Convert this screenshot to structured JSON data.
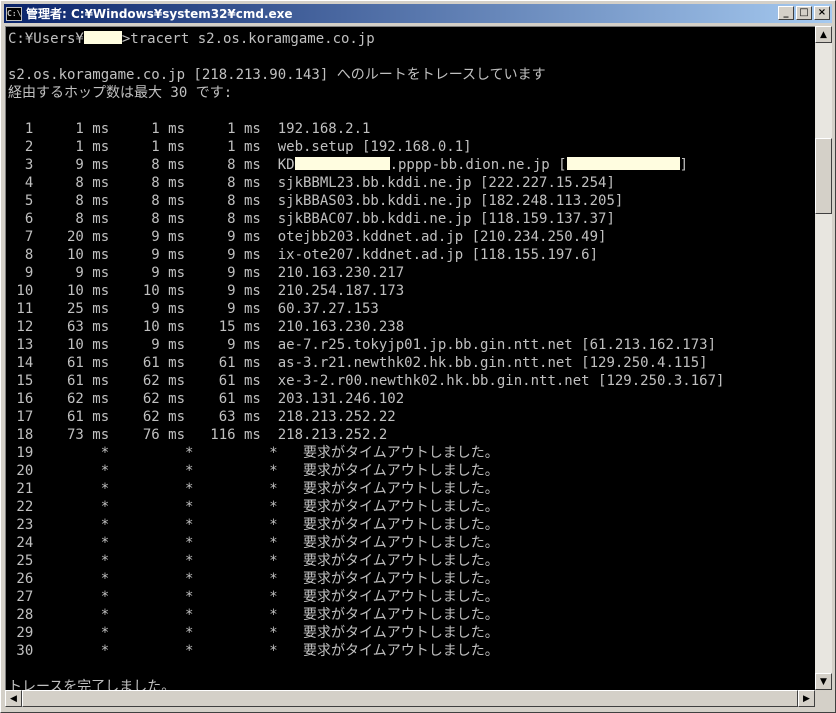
{
  "window": {
    "title": "管理者: C:¥Windows¥system32¥cmd.exe",
    "icon": "cmd-icon",
    "icon_text": "C:\\",
    "buttons": {
      "minimize": "_",
      "maximize": "□",
      "close": "×"
    }
  },
  "console": {
    "prompt_before": "C:¥Users¥",
    "prompt_after": ">tracert s2.os.koramgame.co.jp",
    "header1": "s2.os.koramgame.co.jp [218.213.90.143] へのルートをトレースしています",
    "header2": "経由するホップ数は最大 30 です:",
    "hops": [
      {
        "n": "1",
        "t1": "1 ms",
        "t2": "1 ms",
        "t3": "1 ms",
        "host": "192.168.2.1"
      },
      {
        "n": "2",
        "t1": "1 ms",
        "t2": "1 ms",
        "t3": "1 ms",
        "host": "web.setup [192.168.0.1]"
      },
      {
        "n": "3",
        "t1": "9 ms",
        "t2": "8 ms",
        "t3": "8 ms",
        "host": "KD",
        "host_mid": ".pppp-bb.dion.ne.jp [",
        "host_end": "]"
      },
      {
        "n": "4",
        "t1": "8 ms",
        "t2": "8 ms",
        "t3": "8 ms",
        "host": "sjkBBML23.bb.kddi.ne.jp [222.227.15.254]"
      },
      {
        "n": "5",
        "t1": "8 ms",
        "t2": "8 ms",
        "t3": "8 ms",
        "host": "sjkBBAS03.bb.kddi.ne.jp [182.248.113.205]"
      },
      {
        "n": "6",
        "t1": "8 ms",
        "t2": "8 ms",
        "t3": "8 ms",
        "host": "sjkBBAC07.bb.kddi.ne.jp [118.159.137.37]"
      },
      {
        "n": "7",
        "t1": "20 ms",
        "t2": "9 ms",
        "t3": "9 ms",
        "host": "otejbb203.kddnet.ad.jp [210.234.250.49]"
      },
      {
        "n": "8",
        "t1": "10 ms",
        "t2": "9 ms",
        "t3": "9 ms",
        "host": "ix-ote207.kddnet.ad.jp [118.155.197.6]"
      },
      {
        "n": "9",
        "t1": "9 ms",
        "t2": "9 ms",
        "t3": "9 ms",
        "host": "210.163.230.217"
      },
      {
        "n": "10",
        "t1": "10 ms",
        "t2": "10 ms",
        "t3": "9 ms",
        "host": "210.254.187.173"
      },
      {
        "n": "11",
        "t1": "25 ms",
        "t2": "9 ms",
        "t3": "9 ms",
        "host": "60.37.27.153"
      },
      {
        "n": "12",
        "t1": "63 ms",
        "t2": "10 ms",
        "t3": "15 ms",
        "host": "210.163.230.238"
      },
      {
        "n": "13",
        "t1": "10 ms",
        "t2": "9 ms",
        "t3": "9 ms",
        "host": "ae-7.r25.tokyjp01.jp.bb.gin.ntt.net [61.213.162.173]"
      },
      {
        "n": "14",
        "t1": "61 ms",
        "t2": "61 ms",
        "t3": "61 ms",
        "host": "as-3.r21.newthk02.hk.bb.gin.ntt.net [129.250.4.115]"
      },
      {
        "n": "15",
        "t1": "61 ms",
        "t2": "62 ms",
        "t3": "61 ms",
        "host": "xe-3-2.r00.newthk02.hk.bb.gin.ntt.net [129.250.3.167]"
      },
      {
        "n": "16",
        "t1": "62 ms",
        "t2": "62 ms",
        "t3": "61 ms",
        "host": "203.131.246.102"
      },
      {
        "n": "17",
        "t1": "61 ms",
        "t2": "62 ms",
        "t3": "63 ms",
        "host": "218.213.252.22"
      },
      {
        "n": "18",
        "t1": "73 ms",
        "t2": "76 ms",
        "t3": "116 ms",
        "host": "218.213.252.2"
      },
      {
        "n": "19",
        "t1": "*",
        "t2": "*",
        "t3": "*",
        "host": "要求がタイムアウトしました。"
      },
      {
        "n": "20",
        "t1": "*",
        "t2": "*",
        "t3": "*",
        "host": "要求がタイムアウトしました。"
      },
      {
        "n": "21",
        "t1": "*",
        "t2": "*",
        "t3": "*",
        "host": "要求がタイムアウトしました。"
      },
      {
        "n": "22",
        "t1": "*",
        "t2": "*",
        "t3": "*",
        "host": "要求がタイムアウトしました。"
      },
      {
        "n": "23",
        "t1": "*",
        "t2": "*",
        "t3": "*",
        "host": "要求がタイムアウトしました。"
      },
      {
        "n": "24",
        "t1": "*",
        "t2": "*",
        "t3": "*",
        "host": "要求がタイムアウトしました。"
      },
      {
        "n": "25",
        "t1": "*",
        "t2": "*",
        "t3": "*",
        "host": "要求がタイムアウトしました。"
      },
      {
        "n": "26",
        "t1": "*",
        "t2": "*",
        "t3": "*",
        "host": "要求がタイムアウトしました。"
      },
      {
        "n": "27",
        "t1": "*",
        "t2": "*",
        "t3": "*",
        "host": "要求がタイムアウトしました。"
      },
      {
        "n": "28",
        "t1": "*",
        "t2": "*",
        "t3": "*",
        "host": "要求がタイムアウトしました。"
      },
      {
        "n": "29",
        "t1": "*",
        "t2": "*",
        "t3": "*",
        "host": "要求がタイムアウトしました。"
      },
      {
        "n": "30",
        "t1": "*",
        "t2": "*",
        "t3": "*",
        "host": "要求がタイムアウトしました。"
      }
    ],
    "footer": "トレースを完了しました。"
  },
  "scrollbars": {
    "up": "▲",
    "down": "▼",
    "left": "◀",
    "right": "▶"
  },
  "colors": {
    "console_bg": "#000000",
    "console_text": "#c0c0c0",
    "title_gradient_start": "#0a246a",
    "title_gradient_end": "#a6caf0",
    "redaction": "#fffde0"
  }
}
